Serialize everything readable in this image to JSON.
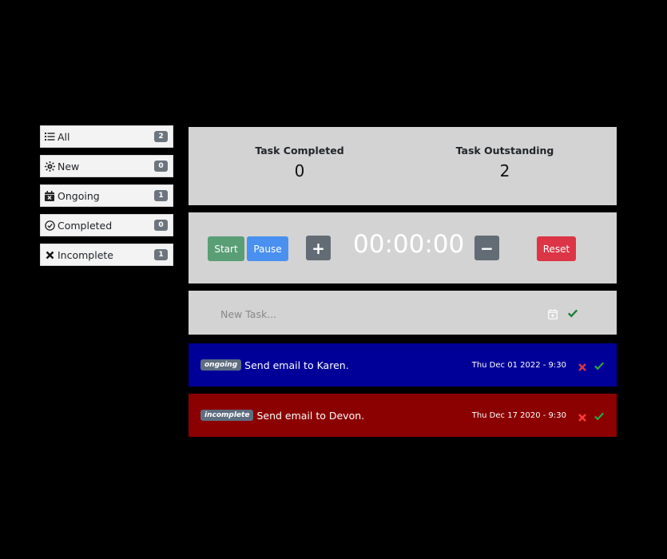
{
  "sidebar": {
    "items": [
      {
        "label": "All",
        "count": "2",
        "icon": "list-icon"
      },
      {
        "label": "New",
        "count": "0",
        "icon": "sun-icon"
      },
      {
        "label": "Ongoing",
        "count": "1",
        "icon": "calendar-x-icon"
      },
      {
        "label": "Completed",
        "count": "0",
        "icon": "check-circle-icon"
      },
      {
        "label": "Incomplete",
        "count": "1",
        "icon": "x-icon"
      }
    ]
  },
  "stats": {
    "completed_label": "Task Completed",
    "completed_value": "0",
    "outstanding_label": "Task Outstanding",
    "outstanding_value": "2"
  },
  "timer": {
    "start_label": "Start",
    "pause_label": "Pause",
    "plus_label": "+",
    "minus_label": "−",
    "clock": "00:00:00",
    "reset_label": "Reset"
  },
  "new_task": {
    "placeholder": "New Task..."
  },
  "tasks": [
    {
      "status": "ongoing",
      "text": "Send email to Karen.",
      "date": "Thu Dec 01 2022 - 9:30"
    },
    {
      "status": "incomplete",
      "text": "Send email to Devon.",
      "date": "Thu Dec 17 2020 - 9:30"
    }
  ],
  "colors": {
    "ongoing_bg": "#000099",
    "incomplete_bg": "#8b0000",
    "start": "#5a9e76",
    "pause": "#4a90f0",
    "reset": "#dc3545",
    "neutral": "#636c75",
    "delete": "#dc3545",
    "complete": "#28a745"
  }
}
